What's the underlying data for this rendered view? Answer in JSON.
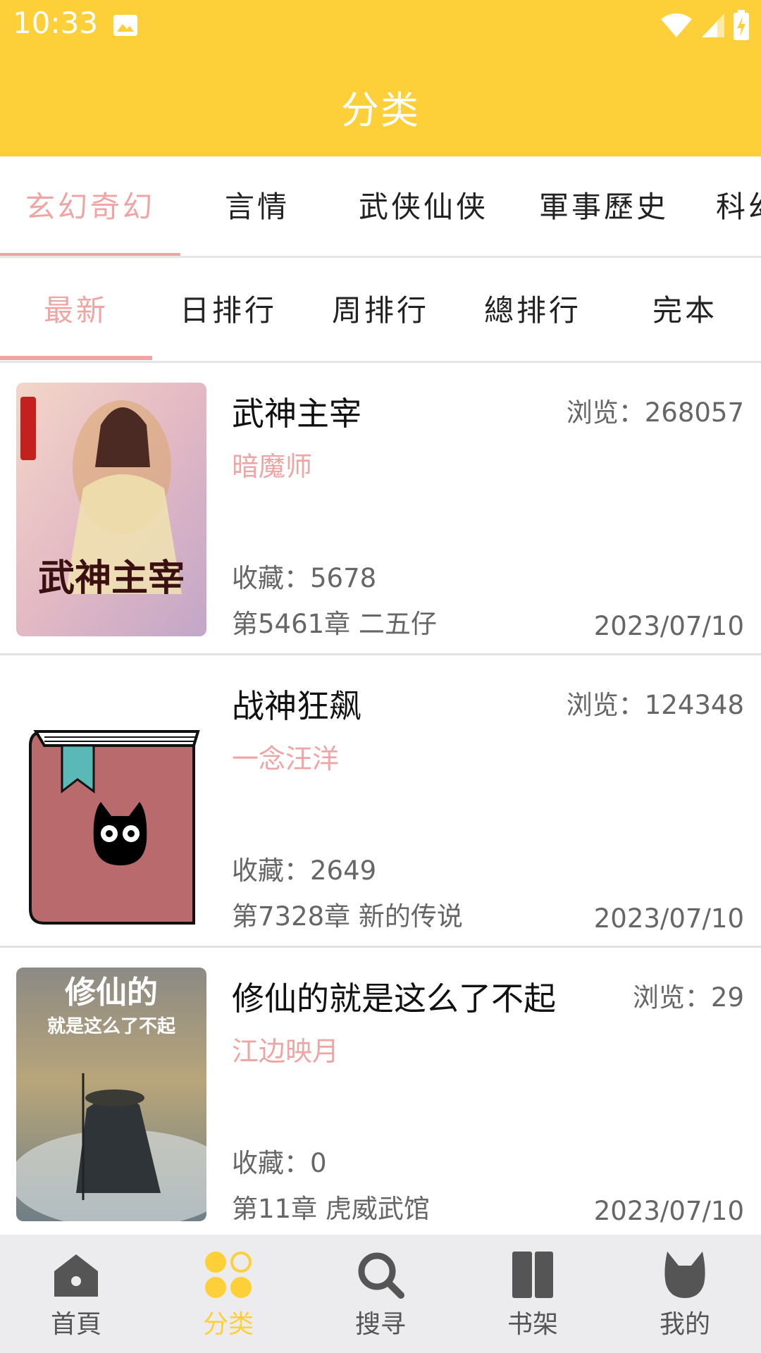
{
  "status_bar": {
    "time": "10:33"
  },
  "header": {
    "title": "分类"
  },
  "category_tabs": [
    "玄幻奇幻",
    "言情",
    "武侠仙侠",
    "軍事歷史",
    "科幻"
  ],
  "sort_tabs": [
    "最新",
    "日排行",
    "周排行",
    "總排行",
    "完本"
  ],
  "books": [
    {
      "title": "武神主宰",
      "author": "暗魔师",
      "views": "浏览：268057",
      "favorites": "收藏：5678",
      "latest_chapter": "第5461章 二五仔",
      "date": "2023/07/10",
      "cover_text": "武神主宰"
    },
    {
      "title": "战神狂飙",
      "author": "一念汪洋",
      "views": "浏览：124348",
      "favorites": "收藏：2649",
      "latest_chapter": "第7328章 新的传说",
      "date": "2023/07/10"
    },
    {
      "title": "修仙的就是这么了不起",
      "author": "江边映月",
      "views": "浏览：29",
      "favorites": "收藏：0",
      "latest_chapter": "第11章 虎威武馆",
      "date": "2023/07/10",
      "cover_text": [
        "修仙的",
        "就是这么了不起"
      ]
    }
  ],
  "bottom_nav": [
    {
      "label": "首頁",
      "icon": "home-icon"
    },
    {
      "label": "分类",
      "icon": "category-icon"
    },
    {
      "label": "搜寻",
      "icon": "search-icon"
    },
    {
      "label": "书架",
      "icon": "bookshelf-icon"
    },
    {
      "label": "我的",
      "icon": "profile-icon"
    }
  ],
  "colors": {
    "accent_yellow": "#fdd039",
    "accent_pink": "#f0a5a5",
    "nav_bg": "#ececef"
  }
}
